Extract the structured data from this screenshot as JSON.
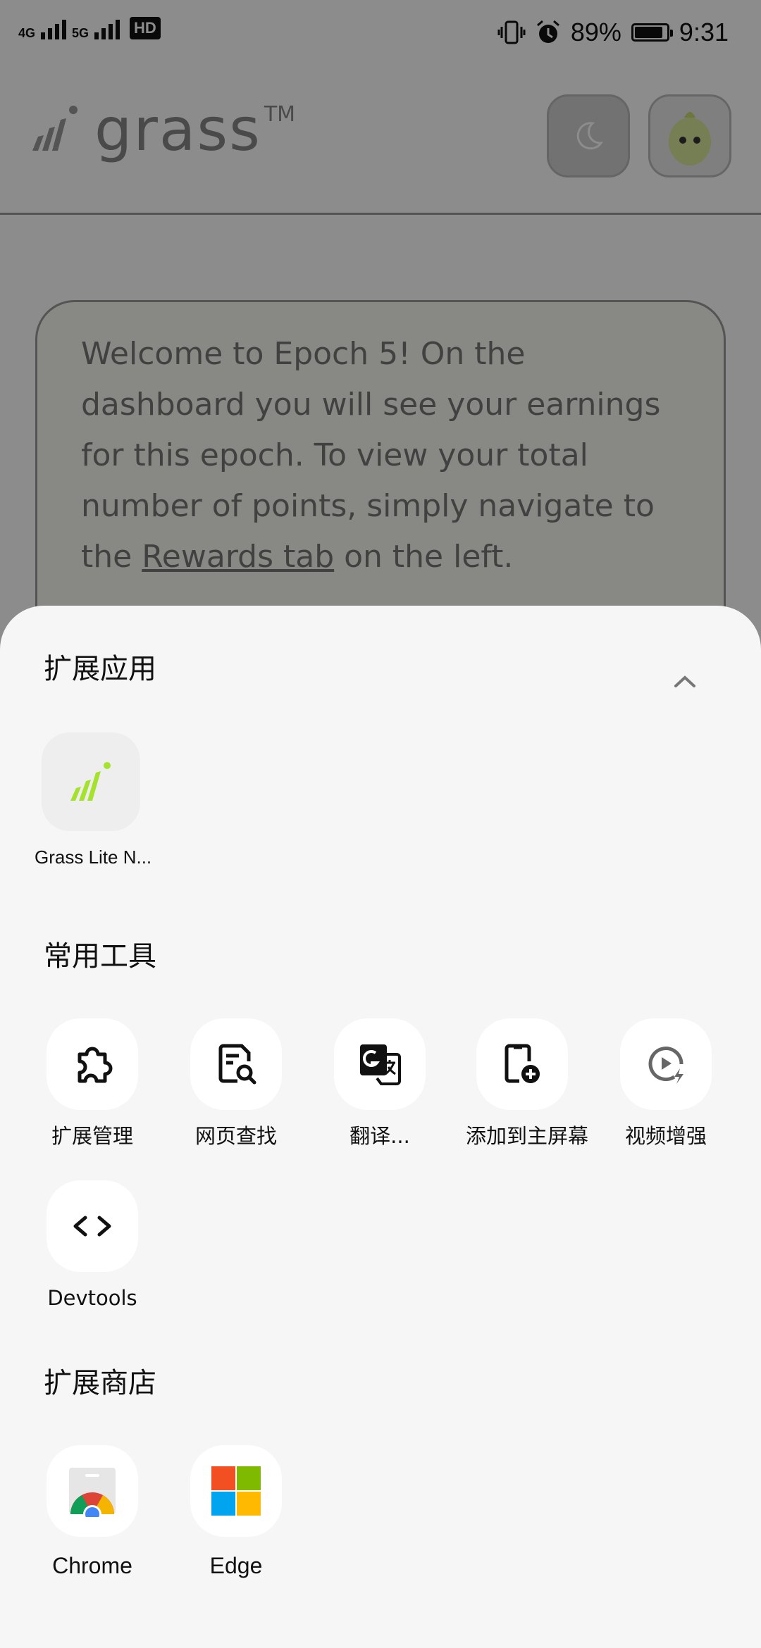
{
  "status_bar": {
    "network_left": "4G",
    "network_right": "5G",
    "hd_badge": "HD",
    "battery_percent": "89%",
    "battery_level": 0.89,
    "time": "9:31"
  },
  "header": {
    "logo_text": "grass",
    "logo_tm": "TM",
    "theme_icon": "moon-icon",
    "avatar_icon": "avatar"
  },
  "welcome": {
    "text_before": "Welcome to Epoch 5! On the dashboard you will see your earnings for this epoch. To view your total number of points, simply navigate to the ",
    "link_text": "Rewards tab",
    "text_after": " on the left."
  },
  "sheet": {
    "extensions_title": "扩展应用",
    "extensions": [
      {
        "label": "Grass Lite N...",
        "icon": "grass-logo-icon"
      }
    ],
    "tools_title": "常用工具",
    "tools": [
      {
        "label": "扩展管理",
        "icon": "puzzle-icon"
      },
      {
        "label": "网页查找",
        "icon": "find-in-page-icon"
      },
      {
        "label": "翻译...",
        "icon": "translate-icon"
      },
      {
        "label": "添加到主屏幕",
        "icon": "add-to-home-icon"
      },
      {
        "label": "视频增强",
        "icon": "video-enhance-icon"
      },
      {
        "label": "Devtools",
        "icon": "code-icon"
      }
    ],
    "store_title": "扩展商店",
    "stores": [
      {
        "label": "Chrome",
        "icon": "chrome-store-icon"
      },
      {
        "label": "Edge",
        "icon": "edge-store-icon"
      }
    ]
  },
  "colors": {
    "sheet_bg": "#f6f6f6",
    "grass_green": "#a5e22d",
    "chrome_red": "#db4437",
    "chrome_green": "#0f9d58",
    "chrome_yellow": "#f4b400",
    "chrome_blue": "#4285f4",
    "ms_red": "#f25022",
    "ms_green": "#7fba00",
    "ms_blue": "#00a4ef",
    "ms_yellow": "#ffb900"
  }
}
